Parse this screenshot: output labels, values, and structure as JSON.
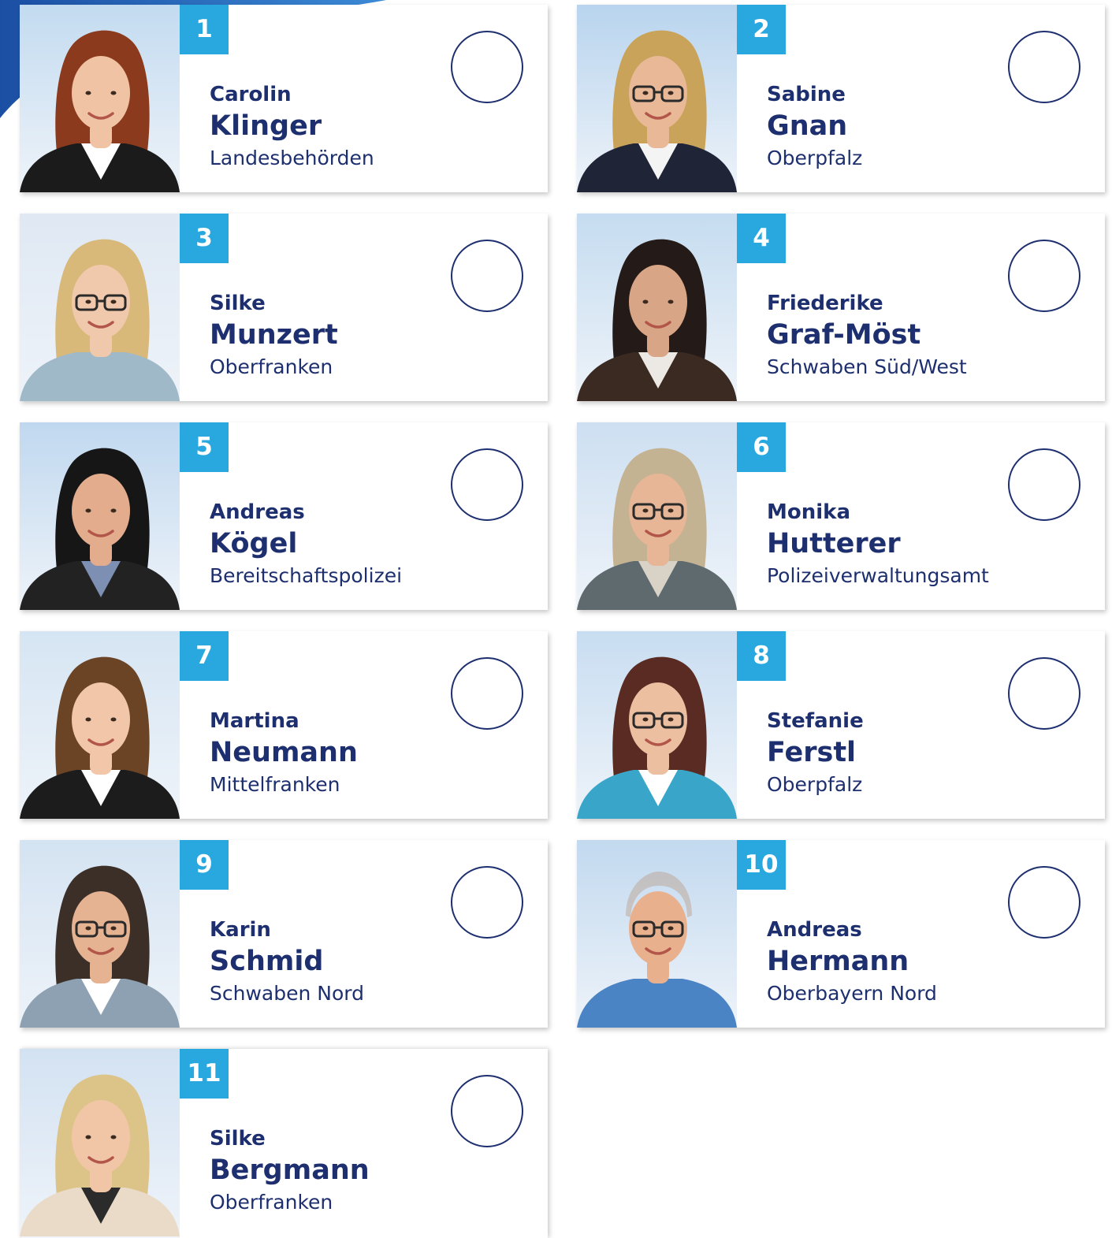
{
  "accent_colors": {
    "badge": "#29a8e0",
    "name_text": "#1d2f6e",
    "vote_circle": "#1d2f6e",
    "corner_swoosh": "#1b4fa3"
  },
  "candidates": [
    {
      "number": "1",
      "first_name": "Carolin",
      "last_name": "Klinger",
      "region": "Landesbehörden",
      "photo": {
        "hair": "#8c3a1d",
        "skin": "#efc3a4",
        "shirt": "#ffffff",
        "jacket": "#1b1b1b",
        "bg": "#c3dbf0",
        "glasses": false
      }
    },
    {
      "number": "2",
      "first_name": "Sabine",
      "last_name": "Gnan",
      "region": "Oberpfalz",
      "photo": {
        "hair": "#c9a35a",
        "skin": "#e8b897",
        "shirt": "#f4f4f4",
        "jacket": "#1f2436",
        "bg": "#b8d4ee",
        "glasses": true
      }
    },
    {
      "number": "3",
      "first_name": "Silke",
      "last_name": "Munzert",
      "region": "Oberfranken",
      "photo": {
        "hair": "#d8b97a",
        "skin": "#f0c8ab",
        "shirt": "#9fb9c9",
        "jacket": "#9fb9c9",
        "bg": "#dfe8f3",
        "glasses": true
      }
    },
    {
      "number": "4",
      "first_name": "Friederike",
      "last_name": "Graf-Möst",
      "region": "Schwaben Süd/West",
      "photo": {
        "hair": "#241a17",
        "skin": "#d9a587",
        "shirt": "#ece8e3",
        "jacket": "#3a2a22",
        "bg": "#c5dcf0",
        "glasses": false
      }
    },
    {
      "number": "5",
      "first_name": "Andreas",
      "last_name": "Kögel",
      "region": "Bereitschaftspolizei",
      "photo": {
        "hair": "#161616",
        "skin": "#e3ad8d",
        "shirt": "#7d8fb3",
        "jacket": "#222222",
        "bg": "#c0d8ef",
        "glasses": false
      }
    },
    {
      "number": "6",
      "first_name": "Monika",
      "last_name": "Hutterer",
      "region": "Polizeiverwaltungsamt",
      "photo": {
        "hair": "#c4b393",
        "skin": "#e6b696",
        "shirt": "#d9d2c7",
        "jacket": "#5f6a6f",
        "bg": "#cddff1",
        "glasses": true
      }
    },
    {
      "number": "7",
      "first_name": "Martina",
      "last_name": "Neumann",
      "region": "Mittelfranken",
      "photo": {
        "hair": "#6b4426",
        "skin": "#f2c7a9",
        "shirt": "#ffffff",
        "jacket": "#1c1c1c",
        "bg": "#d6e5f3",
        "glasses": false
      }
    },
    {
      "number": "8",
      "first_name": "Stefanie",
      "last_name": "Ferstl",
      "region": "Oberpfalz",
      "photo": {
        "hair": "#5a2b22",
        "skin": "#ecbfa0",
        "shirt": "#ffffff",
        "jacket": "#39a6c9",
        "bg": "#c8ddf1",
        "glasses": true
      }
    },
    {
      "number": "9",
      "first_name": "Karin",
      "last_name": "Schmid",
      "region": "Schwaben Nord",
      "photo": {
        "hair": "#3c2f28",
        "skin": "#e6b392",
        "shirt": "#ffffff",
        "jacket": "#8ea1b3",
        "bg": "#d4e3f2",
        "glasses": true
      }
    },
    {
      "number": "10",
      "first_name": "Andreas",
      "last_name": "Hermann",
      "region": "Oberbayern Nord",
      "photo": {
        "hair": "#b58a6a",
        "skin": "#e9b08e",
        "shirt": "#4a84c4",
        "jacket": "#4a84c4",
        "bg": "#c2d9ef",
        "glasses": true,
        "bald": true
      }
    },
    {
      "number": "11",
      "first_name": "Silke",
      "last_name": "Bergmann",
      "region": "Oberfranken",
      "photo": {
        "hair": "#dcc387",
        "skin": "#f1c6a7",
        "shirt": "#2b2b2b",
        "jacket": "#eadbc8",
        "bg": "#d3e2f2",
        "glasses": false
      }
    }
  ]
}
